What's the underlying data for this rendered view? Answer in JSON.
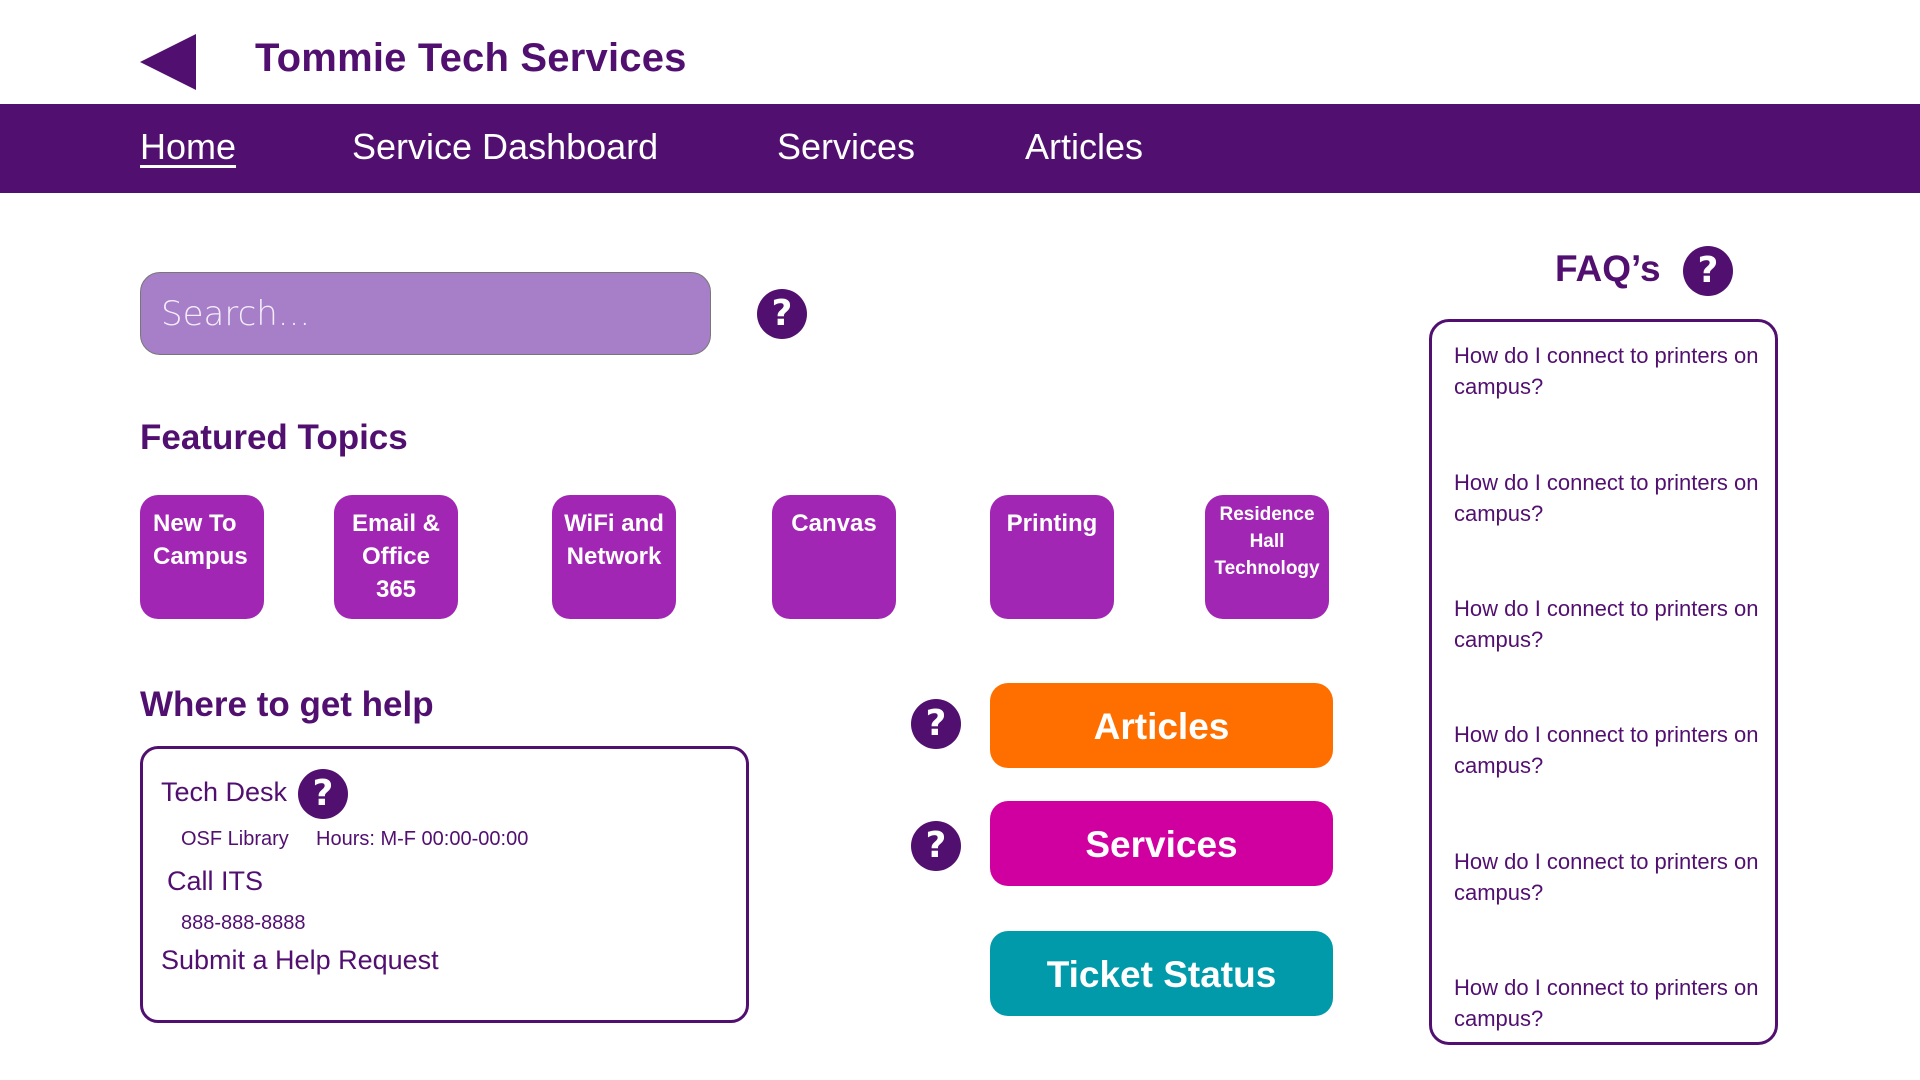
{
  "header": {
    "back_icon": "back-triangle-icon",
    "title": "Tommie Tech Services"
  },
  "nav": {
    "items": [
      {
        "label": "Home",
        "active": true
      },
      {
        "label": "Service Dashboard",
        "active": false
      },
      {
        "label": "Services",
        "active": false
      },
      {
        "label": "Articles",
        "active": false
      }
    ]
  },
  "search": {
    "placeholder": "Search...",
    "value": "",
    "help_icon": "question-icon"
  },
  "featured": {
    "title": "Featured Topics",
    "tiles": [
      {
        "label": "New To Campus"
      },
      {
        "label": "Email & Office 365"
      },
      {
        "label": "WiFi and Network"
      },
      {
        "label": "Canvas"
      },
      {
        "label": "Printing"
      },
      {
        "label": "Residence Hall Technology"
      }
    ]
  },
  "help": {
    "title": "Where to get help",
    "tech_desk": "Tech Desk",
    "location": "OSF Library",
    "hours": "Hours: M-F 00:00-00:00",
    "call": "Call ITS",
    "phone": "888-888-8888",
    "submit": "Submit a Help Request"
  },
  "actions": {
    "articles": {
      "label": "Articles",
      "color": "#FF6F00"
    },
    "services": {
      "label": "Services",
      "color": "#D000A0"
    },
    "ticket": {
      "label": "Ticket Status",
      "color": "#009AAA"
    }
  },
  "faq": {
    "title": "FAQ’s",
    "items": [
      "How do I connect to printers on campus?",
      "How do I connect to printers on campus?",
      "How do I connect to printers on campus?",
      "How do I connect to printers on campus?",
      "How do I connect to printers on campus?",
      "How do I connect to printers on campus?"
    ]
  },
  "colors": {
    "brand": "#510F70",
    "tile": "#A126B4",
    "search_bg": "#A77EC8"
  },
  "icons": {
    "question": "?"
  }
}
